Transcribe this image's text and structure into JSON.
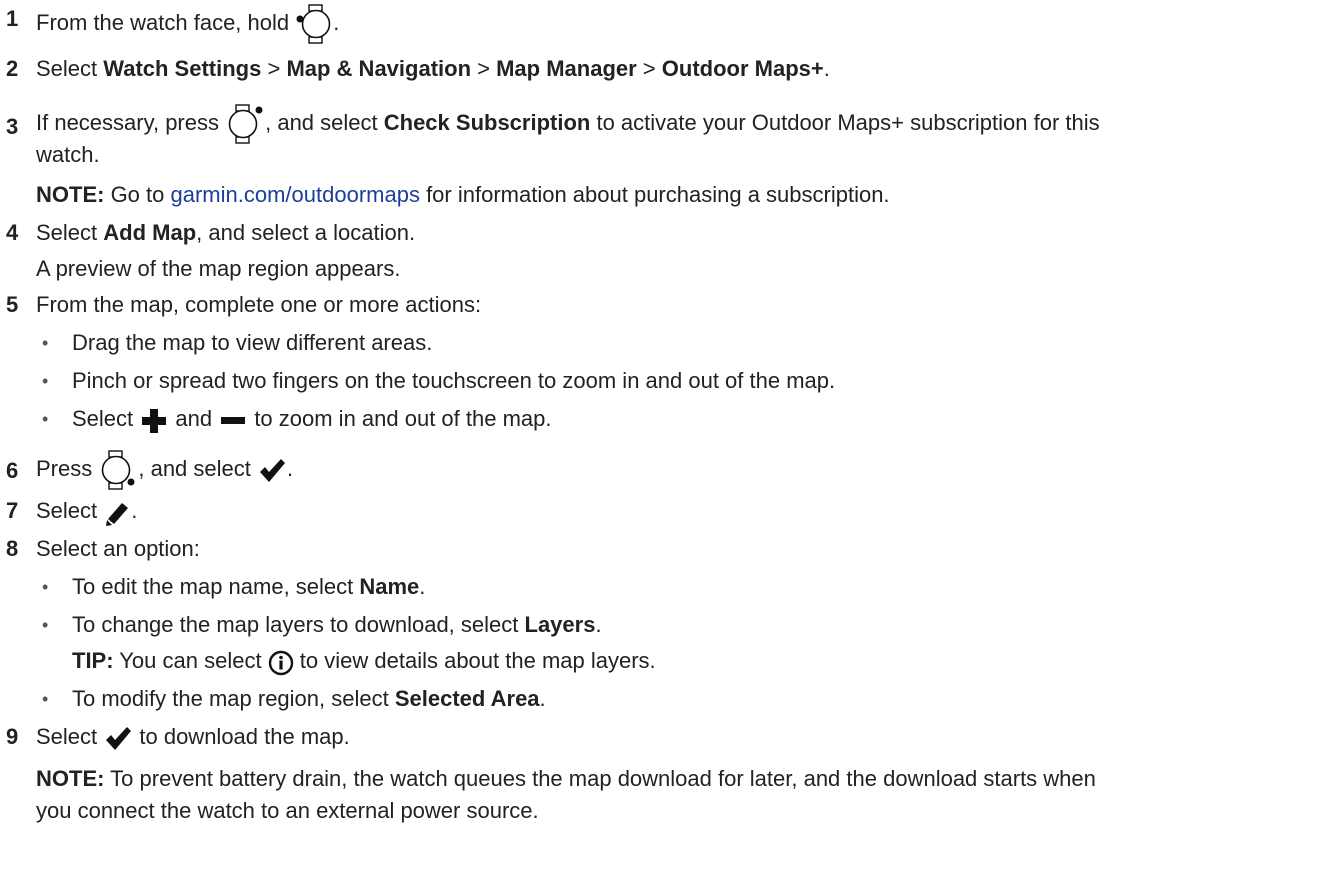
{
  "steps": [
    {
      "num": "1",
      "a": "From the watch face, hold ",
      "b": "."
    },
    {
      "num": "2",
      "a": "Select ",
      "b1": "Watch Settings",
      "s1": " > ",
      "b2": "Map & Navigation",
      "s2": " > ",
      "b3": "Map Manager",
      "s3": " > ",
      "b4": "Outdoor Maps+",
      "end": "."
    },
    {
      "num": "3",
      "a": "If necessary, press ",
      "b": ", and select ",
      "bold": "Check Subscription",
      "c": " to activate your Outdoor Maps+ subscription for this",
      "d": "watch."
    },
    {
      "num": "4",
      "a": "Select ",
      "bold": "Add Map",
      "b": ", and select a location.",
      "sub": "A preview of the map region appears."
    },
    {
      "num": "5",
      "a": "From the map, complete one or more actions:"
    },
    {
      "num": "6",
      "a": "Press ",
      "b": ", and select ",
      "c": "."
    },
    {
      "num": "7",
      "a": "Select ",
      "b": "."
    },
    {
      "num": "8",
      "a": "Select an option:"
    },
    {
      "num": "9",
      "a": "Select ",
      "b": " to download the map."
    }
  ],
  "note3": {
    "label": "NOTE:",
    "a": " Go to ",
    "link": "garmin.com/outdoormaps",
    "b": " for information about purchasing a subscription."
  },
  "bullets5": [
    {
      "a": "Drag the map to view different areas."
    },
    {
      "a": "Pinch or spread two fingers on the touchscreen to zoom in and out of the map."
    },
    {
      "a": "Select ",
      "b": " and ",
      "c": " to zoom in and out of the map."
    }
  ],
  "bullets8": [
    {
      "a": "To edit the map name, select ",
      "bold": "Name",
      "end": "."
    },
    {
      "a": "To change the map layers to download, select ",
      "bold": "Layers",
      "end": "."
    },
    {
      "a": "To modify the map region, select ",
      "bold": "Selected Area",
      "end": "."
    }
  ],
  "tip8": {
    "label": "TIP:",
    "a": " You can select ",
    "b": " to view details about the map layers."
  },
  "note9": {
    "label": "NOTE:",
    "a": " To prevent battery drain, the watch queues the map download for later, and the download starts when",
    "b": "you connect the watch to an external power source."
  },
  "bullet_glyph": "•",
  "colors": {
    "text": "#222222",
    "link": "#1d3f9b",
    "icon": "#111111"
  }
}
